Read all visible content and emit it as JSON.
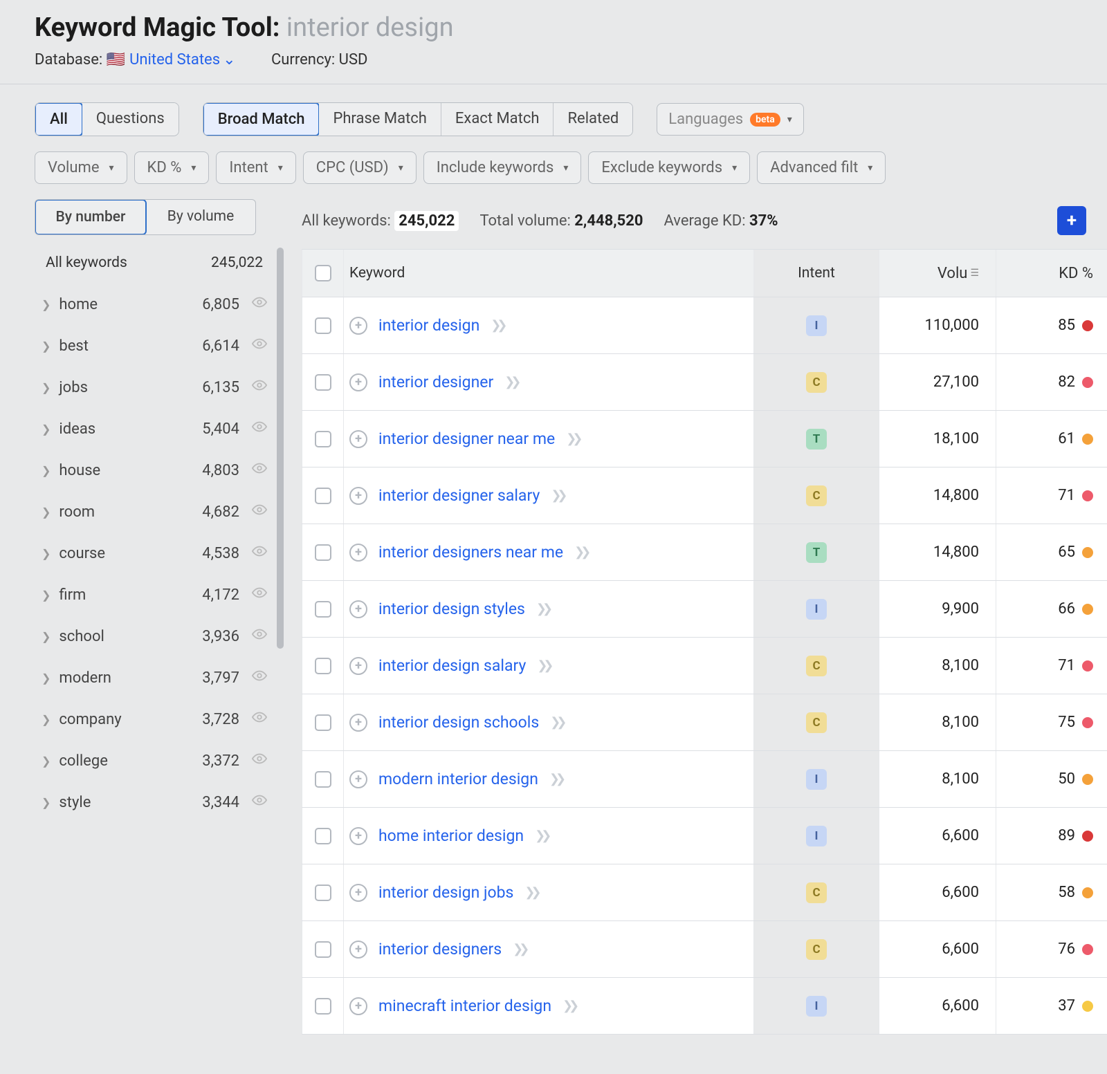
{
  "header": {
    "tool_name": "Keyword Magic Tool:",
    "query": "interior design",
    "database_label": "Database:",
    "database_flag": "🇺🇸",
    "database_value": "United States",
    "currency_label": "Currency:",
    "currency_value": "USD"
  },
  "filter_tabs": {
    "group1": [
      "All",
      "Questions"
    ],
    "group1_active": "All",
    "group2": [
      "Broad Match",
      "Phrase Match",
      "Exact Match",
      "Related"
    ],
    "group2_active": "Broad Match",
    "languages_label": "Languages",
    "languages_badge": "beta"
  },
  "filter_drops": [
    "Volume",
    "KD %",
    "Intent",
    "CPC (USD)",
    "Include keywords",
    "Exclude keywords",
    "Advanced filt"
  ],
  "sidebar": {
    "toggle": [
      "By number",
      "By volume"
    ],
    "toggle_active": "By number",
    "all_keywords_label": "All keywords",
    "all_keywords_count": "245,022",
    "groups": [
      {
        "name": "home",
        "count": "6,805"
      },
      {
        "name": "best",
        "count": "6,614"
      },
      {
        "name": "jobs",
        "count": "6,135"
      },
      {
        "name": "ideas",
        "count": "5,404"
      },
      {
        "name": "house",
        "count": "4,803"
      },
      {
        "name": "room",
        "count": "4,682"
      },
      {
        "name": "course",
        "count": "4,538"
      },
      {
        "name": "firm",
        "count": "4,172"
      },
      {
        "name": "school",
        "count": "3,936"
      },
      {
        "name": "modern",
        "count": "3,797"
      },
      {
        "name": "company",
        "count": "3,728"
      },
      {
        "name": "college",
        "count": "3,372"
      },
      {
        "name": "style",
        "count": "3,344"
      }
    ]
  },
  "stats": {
    "all_keywords_label": "All keywords:",
    "all_keywords_value": "245,022",
    "total_volume_label": "Total volume:",
    "total_volume_value": "2,448,520",
    "avg_kd_label": "Average KD:",
    "avg_kd_value": "37%"
  },
  "table": {
    "headers": {
      "keyword": "Keyword",
      "intent": "Intent",
      "volume": "Volu",
      "kd": "KD %"
    },
    "rows": [
      {
        "keyword": "interior design",
        "intent": "I",
        "volume": "110,000",
        "kd": "85",
        "kd_color": "kd-red"
      },
      {
        "keyword": "interior designer",
        "intent": "C",
        "volume": "27,100",
        "kd": "82",
        "kd_color": "kd-pink"
      },
      {
        "keyword": "interior designer near me",
        "intent": "T",
        "volume": "18,100",
        "kd": "61",
        "kd_color": "kd-orange"
      },
      {
        "keyword": "interior designer salary",
        "intent": "C",
        "volume": "14,800",
        "kd": "71",
        "kd_color": "kd-pink"
      },
      {
        "keyword": "interior designers near me",
        "intent": "T",
        "volume": "14,800",
        "kd": "65",
        "kd_color": "kd-orange"
      },
      {
        "keyword": "interior design styles",
        "intent": "I",
        "volume": "9,900",
        "kd": "66",
        "kd_color": "kd-orange"
      },
      {
        "keyword": "interior design salary",
        "intent": "C",
        "volume": "8,100",
        "kd": "71",
        "kd_color": "kd-pink"
      },
      {
        "keyword": "interior design schools",
        "intent": "C",
        "volume": "8,100",
        "kd": "75",
        "kd_color": "kd-pink"
      },
      {
        "keyword": "modern interior design",
        "intent": "I",
        "volume": "8,100",
        "kd": "50",
        "kd_color": "kd-orange"
      },
      {
        "keyword": "home interior design",
        "intent": "I",
        "volume": "6,600",
        "kd": "89",
        "kd_color": "kd-red"
      },
      {
        "keyword": "interior design jobs",
        "intent": "C",
        "volume": "6,600",
        "kd": "58",
        "kd_color": "kd-orange"
      },
      {
        "keyword": "interior designers",
        "intent": "C",
        "volume": "6,600",
        "kd": "76",
        "kd_color": "kd-pink"
      },
      {
        "keyword": "minecraft interior design",
        "intent": "I",
        "volume": "6,600",
        "kd": "37",
        "kd_color": "kd-yellow"
      }
    ]
  }
}
